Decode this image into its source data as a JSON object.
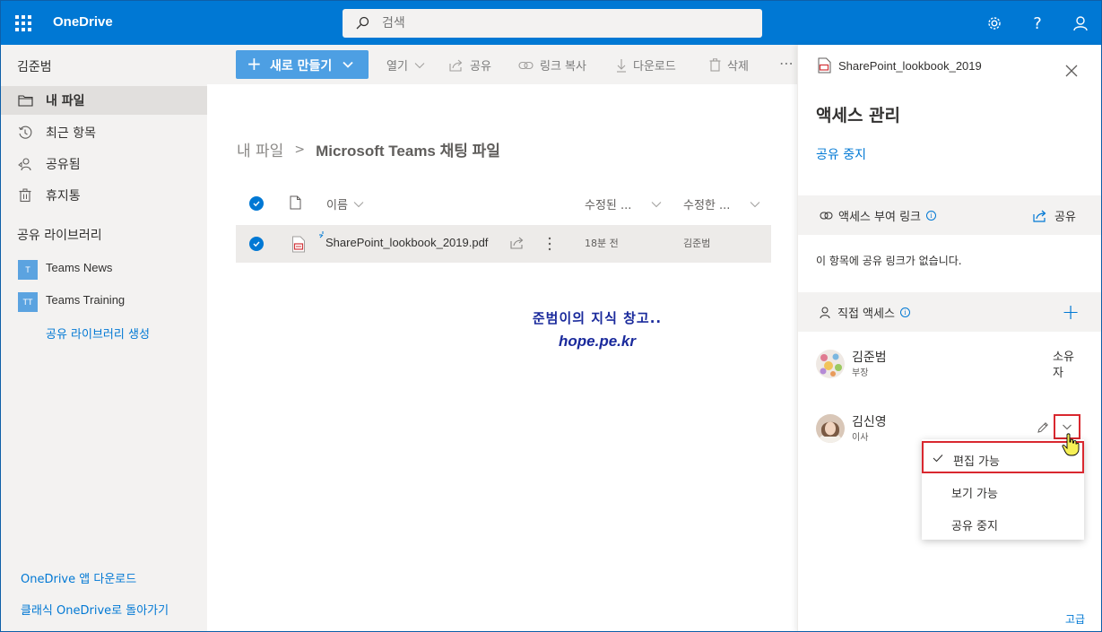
{
  "topbar": {
    "brand": "OneDrive",
    "search_placeholder": "검색",
    "icons": [
      "waffle-icon",
      "gear-icon",
      "help-icon",
      "person-icon"
    ],
    "help_label": "?"
  },
  "leftnav": {
    "user_name": "김준범",
    "items": [
      {
        "label": "내 파일",
        "icon": "folder-icon",
        "active": true
      },
      {
        "label": "최근 항목",
        "icon": "history-icon",
        "active": false
      },
      {
        "label": "공유됨",
        "icon": "shared-icon",
        "active": false
      },
      {
        "label": "휴지통",
        "icon": "trash-icon",
        "active": false
      }
    ],
    "libraries_title": "공유 라이브러리",
    "libraries": [
      {
        "badge": "T",
        "label": "Teams News"
      },
      {
        "badge": "TT",
        "label": "Teams Training"
      }
    ],
    "create_library": "공유 라이브러리 생성",
    "download_app": "OneDrive 앱 다운로드",
    "classic": "클래식 OneDrive로 돌아가기"
  },
  "commandbar": {
    "new_label": "새로 만들기",
    "open_label": "열기",
    "share_label": "공유",
    "copy_link_label": "링크 복사",
    "download_label": "다운로드",
    "delete_label": "삭제",
    "more_label": "⋯"
  },
  "main": {
    "breadcrumb_root": "내 파일",
    "breadcrumb_current": "Microsoft Teams 채팅 파일",
    "columns": {
      "name": "이름",
      "modified": "수정된 ...",
      "modified_by": "수정한 ..."
    },
    "files": [
      {
        "name": "SharePoint_lookbook_2019.pdf",
        "modified": "18분 전",
        "modified_by": "김준범",
        "selected": true
      }
    ],
    "watermark_line1": "준범이의 지식 창고..",
    "watermark_line2": "hope.pe.kr"
  },
  "panel": {
    "file_name": "SharePoint_lookbook_2019",
    "title": "액세스 관리",
    "stop_sharing": "공유 중지",
    "links_section": "액세스 부여 링크",
    "share_label": "공유",
    "no_links": "이 항목에 공유 링크가 없습니다.",
    "direct_section": "직접 액세스",
    "add_label": "+",
    "people": [
      {
        "name": "김준범",
        "role": "부장",
        "permission": "소유자"
      },
      {
        "name": "김신영",
        "role": "이사",
        "permission": "편집 가능"
      }
    ],
    "menu": [
      {
        "label": "편집 가능",
        "checked": true
      },
      {
        "label": "보기 가능",
        "checked": false
      },
      {
        "label": "공유 중지",
        "checked": false
      }
    ],
    "advanced": "고급"
  },
  "colors": {
    "accent": "#0078d4",
    "highlight": "#d9282f",
    "nav_bg": "#f3f2f1"
  }
}
